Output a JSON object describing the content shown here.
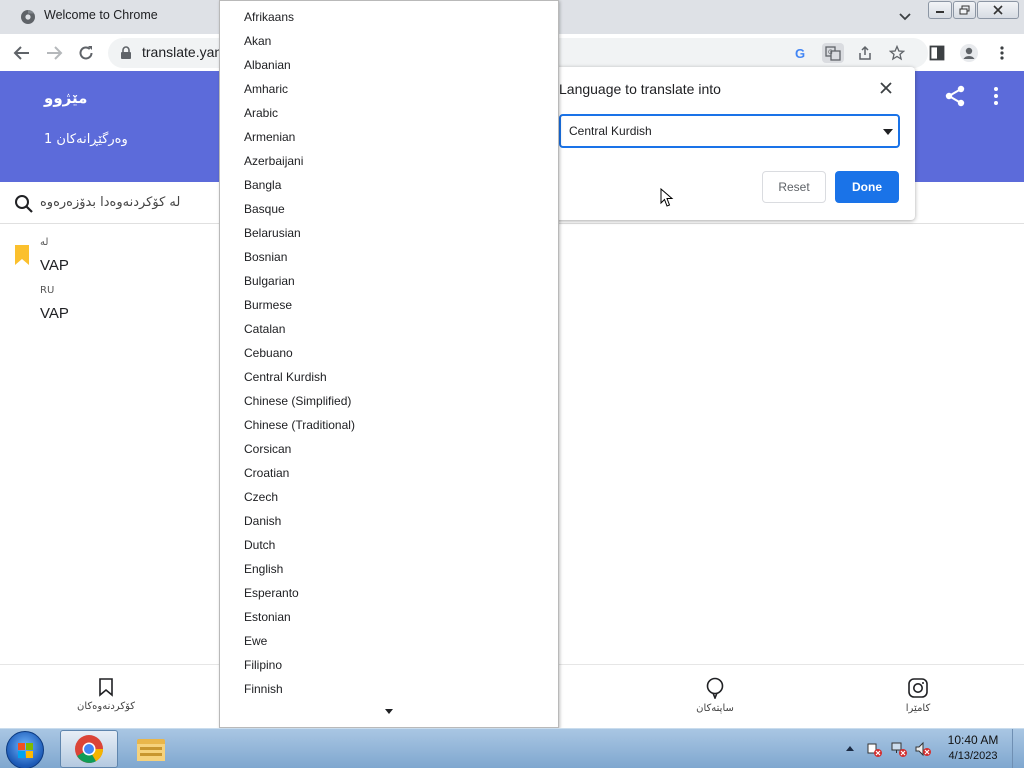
{
  "browser": {
    "tab_title": "Welcome to Chrome",
    "url": "translate.yan"
  },
  "app": {
    "header_title": "مێژوو",
    "header_subtitle": "1 وەرگێڕانەکان",
    "search_placeholder": "لە کۆکردنەوەدا بدۆزەرەوە",
    "history": [
      {
        "lang": "لە",
        "text": "VAP"
      },
      {
        "lang": "RU",
        "text": "VAP"
      }
    ],
    "bottom_nav": [
      {
        "label": "کۆکردنەوەکان",
        "icon": "bookmark-outline-icon"
      },
      {
        "label": "ساپتەکان",
        "icon": "chat-bubble-icon"
      },
      {
        "label": "کامێرا",
        "icon": "camera-icon"
      }
    ],
    "header_color": "#5c6bda"
  },
  "translate_bubble": {
    "title": "Language to translate into",
    "selected_language": "Central Kurdish",
    "reset_label": "Reset",
    "done_label": "Done",
    "accent_color": "#1a73e8"
  },
  "language_list": [
    "Afrikaans",
    "Akan",
    "Albanian",
    "Amharic",
    "Arabic",
    "Armenian",
    "Azerbaijani",
    "Bangla",
    "Basque",
    "Belarusian",
    "Bosnian",
    "Bulgarian",
    "Burmese",
    "Catalan",
    "Cebuano",
    "Central Kurdish",
    "Chinese (Simplified)",
    "Chinese (Traditional)",
    "Corsican",
    "Croatian",
    "Czech",
    "Danish",
    "Dutch",
    "English",
    "Esperanto",
    "Estonian",
    "Ewe",
    "Filipino",
    "Finnish"
  ],
  "taskbar": {
    "time": "10:40 AM",
    "date": "4/13/2023"
  }
}
